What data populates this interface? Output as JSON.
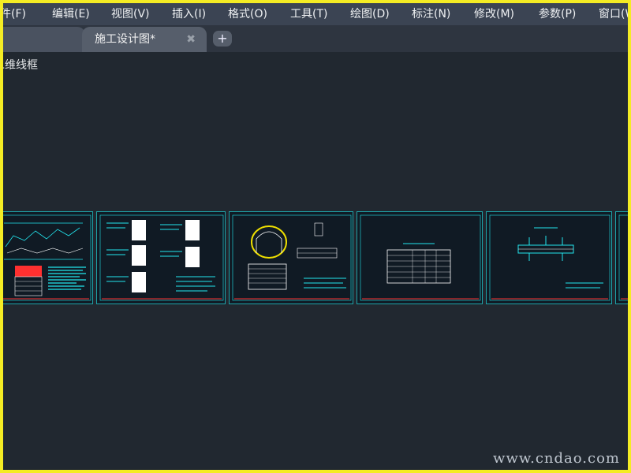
{
  "menubar": {
    "items": [
      {
        "label": "文件(F)"
      },
      {
        "label": "编辑(E)"
      },
      {
        "label": "视图(V)"
      },
      {
        "label": "插入(I)"
      },
      {
        "label": "格式(O)"
      },
      {
        "label": "工具(T)"
      },
      {
        "label": "绘图(D)"
      },
      {
        "label": "标注(N)"
      },
      {
        "label": "修改(M)"
      },
      {
        "label": "参数(P)"
      },
      {
        "label": "窗口(W)"
      }
    ]
  },
  "tabs": [
    {
      "label": "",
      "active": false
    },
    {
      "label": "施工设计图*",
      "active": true
    }
  ],
  "tab_close_icon": "close-icon",
  "tab_add_icon": "plus-icon",
  "viewport": {
    "label": "二维线框"
  },
  "watermark": "www.cndao.com",
  "colors": {
    "frame": "#f4ec24",
    "background": "#212830",
    "menubar": "#3b4453",
    "sheet_border": "#1ea3a8",
    "drawing_cyan": "#22e6ee",
    "drawing_white": "#ffffff",
    "drawing_red": "#ff3030",
    "drawing_yellow": "#f0e000"
  }
}
